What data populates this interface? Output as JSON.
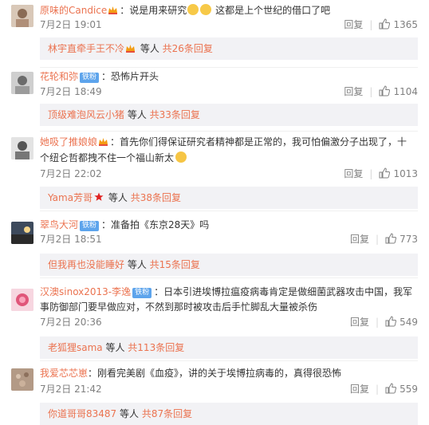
{
  "comments": [
    {
      "user": "原味的Candice",
      "badge": "",
      "text_a": "：说是用来研究",
      "text_b": " 这都是上个世纪的借口了吧",
      "time": "7月2日 19:01",
      "reply_label": "回复",
      "likes": "1365",
      "sub_user": "林宇直牵手王不冷",
      "sub_mid": " 等人 ",
      "sub_count": "共26条回复"
    },
    {
      "user": "花轮和弥",
      "badge": "铁粉",
      "text_a": "：恐怖片开头",
      "time": "7月2日 18:49",
      "reply_label": "回复",
      "likes": "1104",
      "sub_user": "顶级难泡风云小猪",
      "sub_mid": " 等人 ",
      "sub_count": "共33条回复"
    },
    {
      "user": "她吸了推娘娘",
      "badge": "",
      "text_a": "：首先你们得保证研究者精神都是正常的，我可怕偏激分子出现了，十",
      "text_b": "个纽仑哲都拽不住一个福山新太",
      "time": "7月2日 22:02",
      "reply_label": "回复",
      "likes": "1013",
      "sub_user": "Yama芳哥",
      "sub_mid": " 等人 ",
      "sub_count": "共38条回复"
    },
    {
      "user": "翠鸟大河",
      "badge": "铁粉",
      "text_a": "：准备拍《东京28天》吗",
      "time": "7月2日 18:51",
      "reply_label": "回复",
      "likes": "773",
      "sub_user": "但我再也没能睡好",
      "sub_mid": " 等人 ",
      "sub_count": "共15条回复"
    },
    {
      "user": "汉澳sinox2013-李逸",
      "badge": "铁粉",
      "text_a": "：日本引进埃博拉瘟疫病毒肯定是做细菌武器攻击中国，我军",
      "text_b": "事防御部门要早做应对，不然到那时被攻击后手忙脚乱大量被杀伤",
      "time": "7月2日 20:36",
      "reply_label": "回复",
      "likes": "549",
      "sub_user": "老狐狸sama",
      "sub_mid": " 等人 ",
      "sub_count": "共113条回复"
    },
    {
      "user": "我爱芯芯崽",
      "badge": "",
      "text_a": "：刚看完美剧《血疫》，讲的关于埃博拉病毒的，真得很恐怖",
      "time": "7月2日 21:42",
      "reply_label": "回复",
      "likes": "559",
      "sub_user": "你道哥哥83487",
      "sub_mid": " 等人 ",
      "sub_count": "共87条回复"
    }
  ],
  "icons": {
    "crown": "crown-icon",
    "cat": "cat-emoji-icon",
    "thinking": "thinking-emoji-icon",
    "thumb": "thumb-up-icon",
    "star": "red-star-icon"
  },
  "colors": {
    "username": "#eb7350",
    "badge": "#5da4ec",
    "meta": "#808080",
    "sub_bg": "#f2f2f5"
  }
}
